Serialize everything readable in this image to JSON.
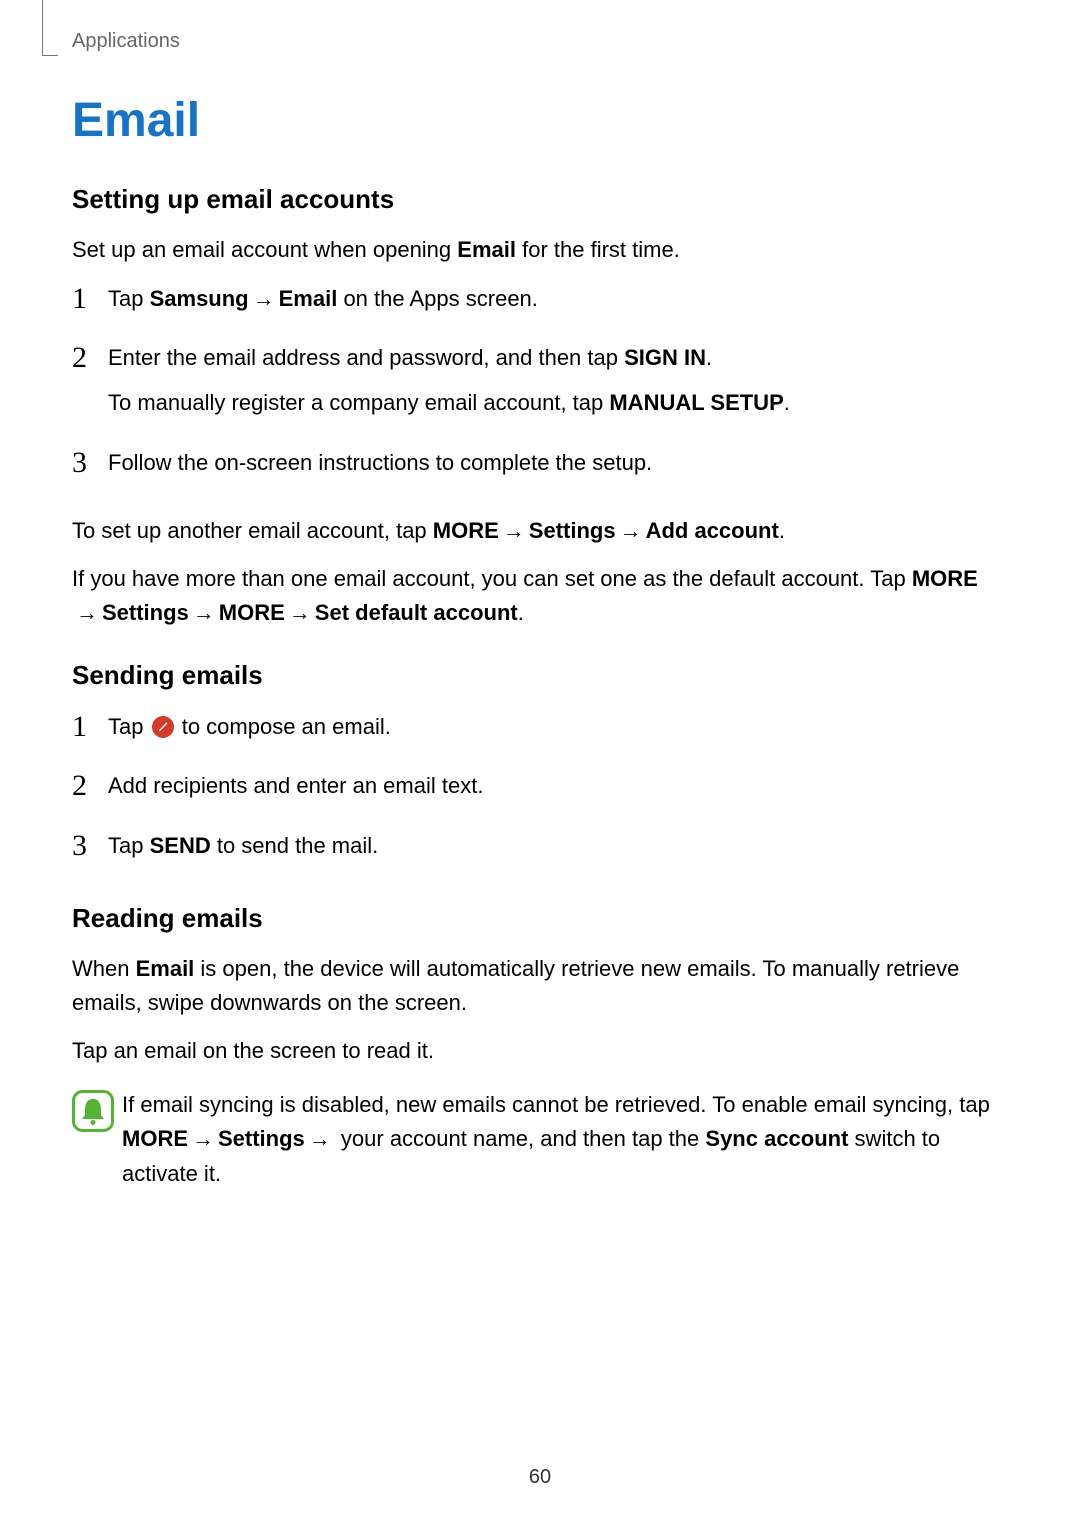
{
  "header": {
    "label": "Applications"
  },
  "page_number": "60",
  "title": "Email",
  "sections": {
    "setup": {
      "title": "Setting up email accounts",
      "intro_a": "Set up an email account when opening ",
      "intro_b": "Email",
      "intro_c": " for the first time.",
      "step1": {
        "a": "Tap ",
        "b": "Samsung",
        "c": "Email",
        "d": " on the Apps screen."
      },
      "step2": {
        "l1a": "Enter the email address and password, and then tap ",
        "l1b": "SIGN IN",
        "l1c": ".",
        "l2a": "To manually register a company email account, tap ",
        "l2b": "MANUAL SETUP",
        "l2c": "."
      },
      "step3": {
        "a": "Follow the on-screen instructions to complete the setup."
      },
      "after1": {
        "a": "To set up another email account, tap ",
        "more": "MORE",
        "settings": "Settings",
        "add": "Add account",
        "end": "."
      },
      "after2": {
        "a": "If you have more than one email account, you can set one as the default account. Tap ",
        "more": "MORE",
        "settings": "Settings",
        "more2": "MORE",
        "setdef": "Set default account",
        "end": "."
      }
    },
    "sending": {
      "title": "Sending emails",
      "step1": {
        "a": "Tap ",
        "b": " to compose an email."
      },
      "step2": {
        "a": "Add recipients and enter an email text."
      },
      "step3": {
        "a": "Tap ",
        "b": "SEND",
        "c": " to send the mail."
      }
    },
    "reading": {
      "title": "Reading emails",
      "p1a": "When ",
      "p1b": "Email",
      "p1c": " is open, the device will automatically retrieve new emails. To manually retrieve emails, swipe downwards on the screen.",
      "p2": "Tap an email on the screen to read it.",
      "tip": {
        "a": "If email syncing is disabled, new emails cannot be retrieved. To enable email syncing, tap ",
        "more": "MORE",
        "settings": "Settings",
        "b": " your account name, and then tap the ",
        "sync": "Sync account",
        "c": " switch to activate it."
      }
    }
  },
  "nums": {
    "n1": "1",
    "n2": "2",
    "n3": "3"
  },
  "glyphs": {
    "arrow": " → "
  }
}
